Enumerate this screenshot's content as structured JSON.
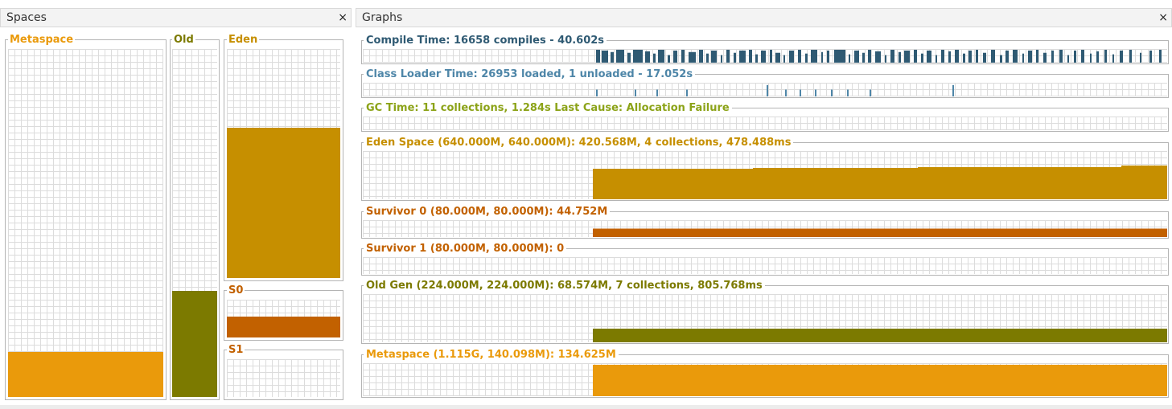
{
  "spaces_panel": {
    "title": "Spaces",
    "close_glyph": "×",
    "metaspace": {
      "label": "Metaspace",
      "color": "#ea9a0b",
      "used_fraction": 0.13
    },
    "old": {
      "label": "Old",
      "color": "#7c7a00",
      "used_fraction": 0.305
    },
    "eden": {
      "label": "Eden",
      "color": "#c68f00",
      "used_fraction": 0.657
    },
    "s0": {
      "label": "S0",
      "color": "#c26100",
      "used_fraction": 0.56
    },
    "s1": {
      "label": "S1",
      "color": "#c26100",
      "used_fraction": 0
    }
  },
  "graphs_panel": {
    "title": "Graphs",
    "close_glyph": "×",
    "compile": {
      "label": "Compile Time: 16658 compiles - 40.602s",
      "color": "#2f5a73"
    },
    "classloader": {
      "label": "Class Loader Time: 26953 loaded, 1 unloaded - 17.052s",
      "color": "#4e86a8"
    },
    "gc": {
      "label": "GC Time: 11 collections, 1.284s  Last Cause: Allocation Failure",
      "color": "#8ca318"
    },
    "eden": {
      "label": "Eden Space (640.000M, 640.000M): 420.568M, 4 collections, 478.488ms",
      "color": "#c68f00"
    },
    "survivor0": {
      "label": "Survivor 0 (80.000M, 80.000M): 44.752M",
      "color": "#c26100"
    },
    "survivor1": {
      "label": "Survivor 1 (80.000M, 80.000M): 0",
      "color": "#c26100"
    },
    "oldgen": {
      "label": "Old Gen (224.000M, 224.000M): 68.574M, 7 collections, 805.768ms",
      "color": "#7c7a00"
    },
    "metaspace": {
      "label": "Metaspace (1.115G, 140.098M): 134.625M",
      "color": "#ea9a0b"
    }
  }
}
